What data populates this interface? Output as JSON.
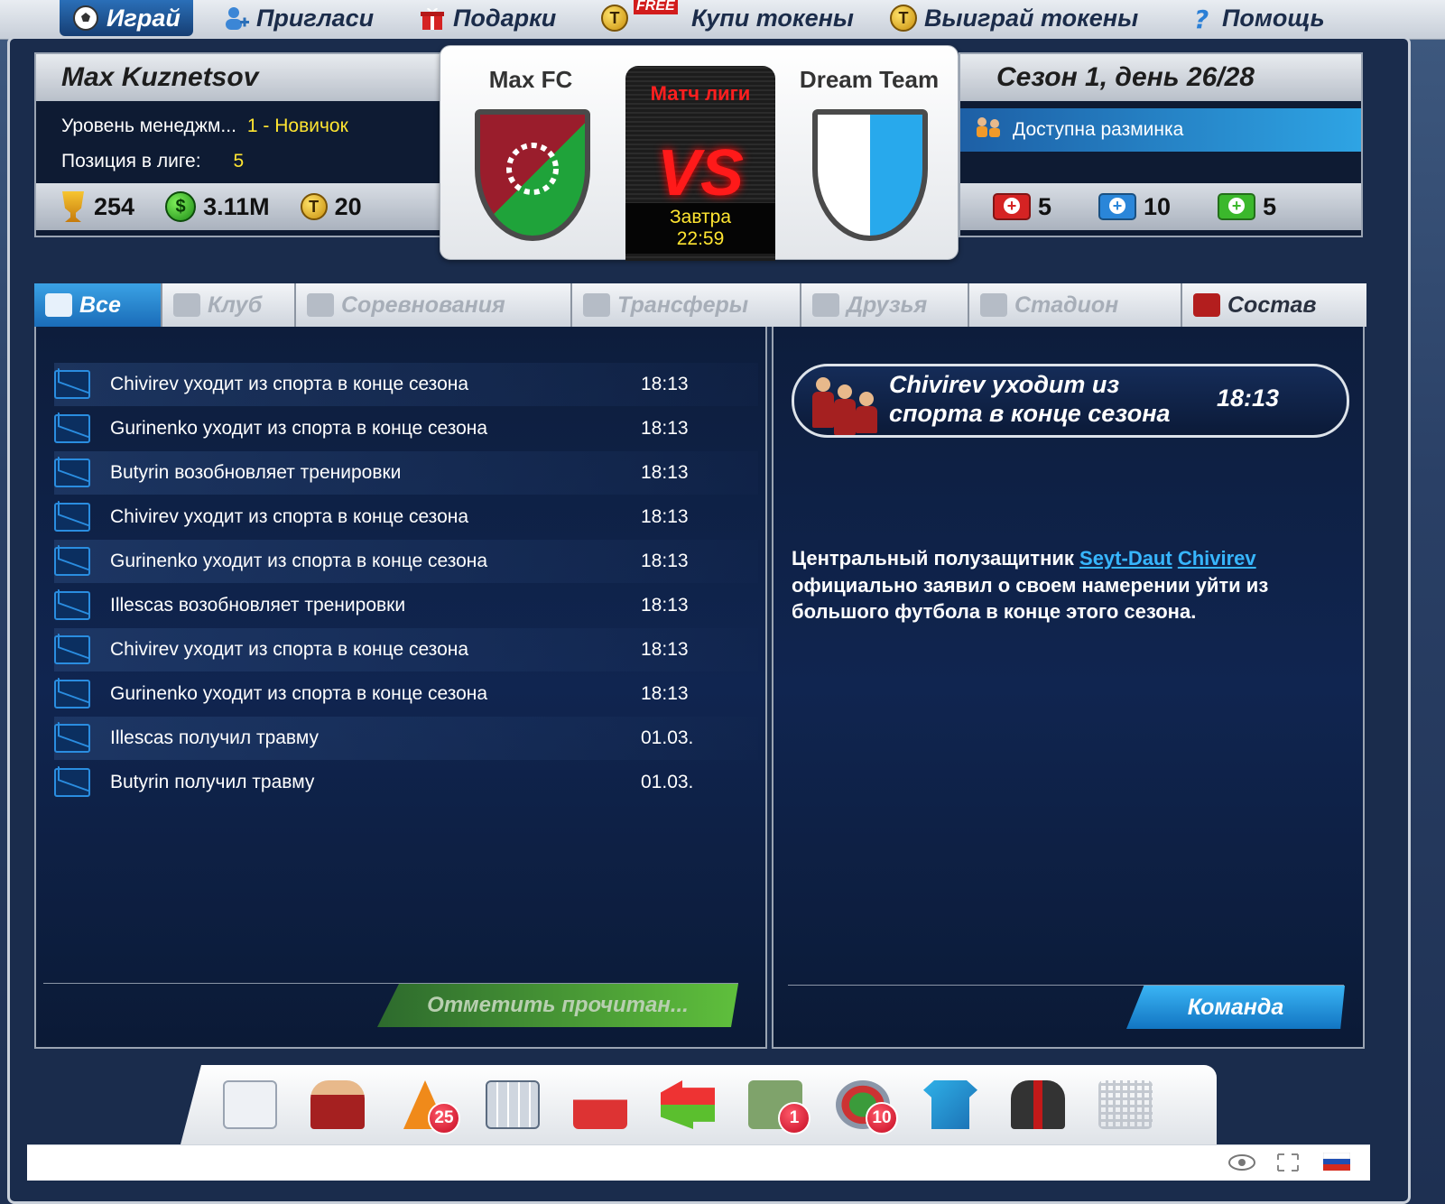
{
  "nav": {
    "items": [
      {
        "label": "Играй",
        "icon": "soccer-ball-icon",
        "active": true
      },
      {
        "label": "Пригласи",
        "icon": "add-user-icon"
      },
      {
        "label": "Подарки",
        "icon": "gift-icon"
      },
      {
        "label": "Купи токены",
        "icon": "token-icon",
        "badge": "FREE"
      },
      {
        "label": "Выиграй токены",
        "icon": "token-icon"
      },
      {
        "label": "Помощь",
        "icon": "help-icon"
      }
    ]
  },
  "manager": {
    "name": "Max Kuznetsov",
    "level_label": "Уровень менеджм...",
    "level_value": "1 - Новичок",
    "position_label": "Позиция в лиге:",
    "position_value": "5",
    "trophies": "254",
    "money": "3.11M",
    "tokens": "20"
  },
  "match": {
    "home_team": "Max FC",
    "away_team": "Dream Team",
    "type_label": "Матч лиги",
    "vs": "VS",
    "day": "Завтра",
    "time": "22:59"
  },
  "season": {
    "title": "Сезон 1, день 26/28",
    "warmup": "Доступна разминка",
    "red_kits": "5",
    "blue_kits": "10",
    "green_kits": "5"
  },
  "tabs": [
    {
      "label": "Все",
      "icon": "envelope-icon",
      "active": true
    },
    {
      "label": "Клуб",
      "icon": "jersey-icon"
    },
    {
      "label": "Соревнования",
      "icon": "podium-icon"
    },
    {
      "label": "Трансферы",
      "icon": "transfer-arrows-icon"
    },
    {
      "label": "Друзья",
      "icon": "friend-icon"
    },
    {
      "label": "Стадион",
      "icon": "stadium-icon"
    },
    {
      "label": "Состав",
      "icon": "players-icon"
    }
  ],
  "messages": [
    {
      "text": "Chivirev уходит из спорта в конце сезона",
      "time": "18:13"
    },
    {
      "text": "Gurinenko уходит из спорта в конце сезона",
      "time": "18:13"
    },
    {
      "text": "Butyrin возобновляет тренировки",
      "time": "18:13"
    },
    {
      "text": "Chivirev уходит из спорта в конце сезона",
      "time": "18:13"
    },
    {
      "text": "Gurinenko уходит из спорта в конце сезона",
      "time": "18:13"
    },
    {
      "text": "Illescas возобновляет тренировки",
      "time": "18:13"
    },
    {
      "text": "Chivirev уходит из спорта в конце сезона",
      "time": "18:13"
    },
    {
      "text": "Gurinenko уходит из спорта в конце сезона",
      "time": "18:13"
    },
    {
      "text": "Illescas получил травму",
      "time": "01.03."
    },
    {
      "text": "Butyrin получил травму",
      "time": "01.03."
    }
  ],
  "mark_read_label": "Отметить прочитан...",
  "detail": {
    "title": "Chivirev уходит из спорта в конце сезона",
    "time": "18:13",
    "body_prefix": "Центральный полузащитник ",
    "link_first": "Seyt-Daut",
    "link_last": "Chivirev",
    "body_suffix": " официально заявил о своем намерении уйти из большого футбола в конце этого сезона.",
    "team_button": "Команда"
  },
  "dock": [
    {
      "icon": "mail-icon"
    },
    {
      "icon": "squad-icon"
    },
    {
      "icon": "training-cone-icon",
      "badge": "25"
    },
    {
      "icon": "calendar-icon"
    },
    {
      "icon": "league-table-icon"
    },
    {
      "icon": "transfers-icon"
    },
    {
      "icon": "finances-icon",
      "badge": "1"
    },
    {
      "icon": "stadium-icon",
      "badge": "10"
    },
    {
      "icon": "club-kit-icon"
    },
    {
      "icon": "staff-icon"
    },
    {
      "icon": "shop-cart-icon"
    }
  ],
  "colors": {
    "accent_blue": "#2a8de0",
    "highlight_yellow": "#ffe531",
    "vs_red": "#ff1a1a",
    "badge_red": "#c40a22"
  }
}
